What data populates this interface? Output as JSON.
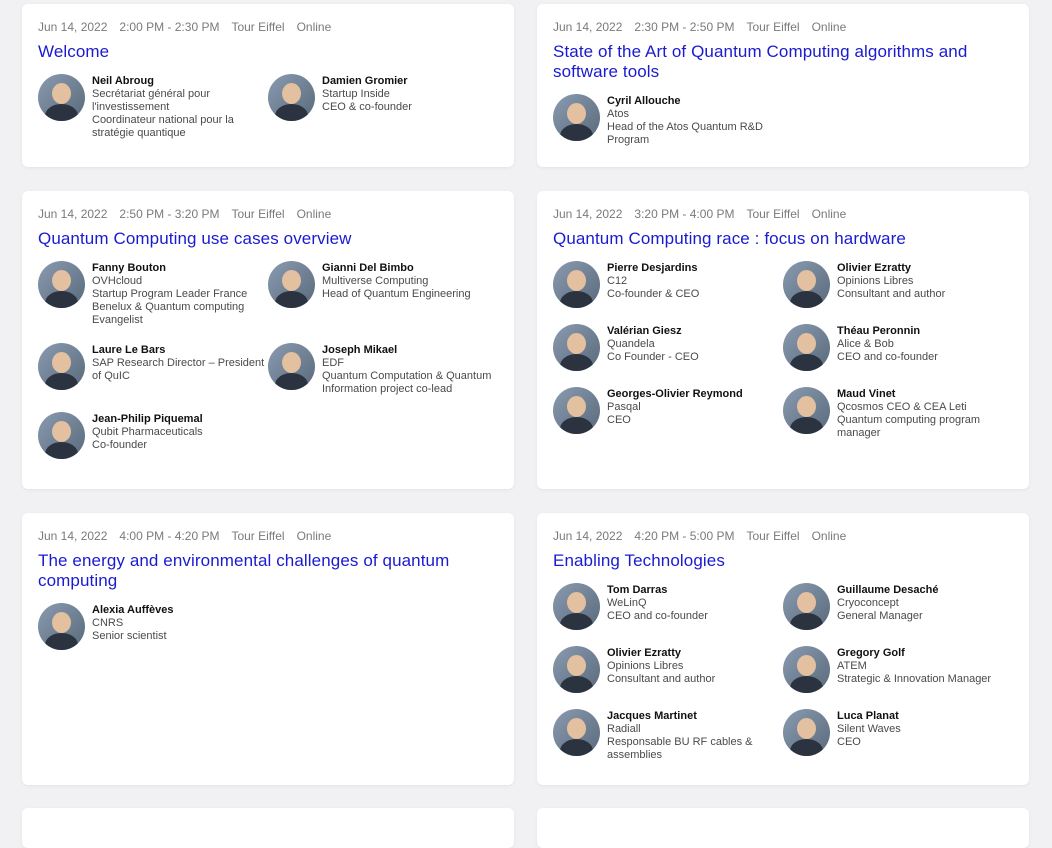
{
  "sessions": [
    {
      "date": "Jun 14, 2022",
      "time": "2:00 PM - 2:30 PM",
      "venue": "Tour Eiffel",
      "mode": "Online",
      "title": "Welcome",
      "speakers": [
        {
          "name": "Neil Abroug",
          "lines": [
            "Secrétariat général pour l'investissement",
            "Coordinateur national pour la stratégie quantique"
          ]
        },
        {
          "name": "Damien Gromier",
          "lines": [
            "Startup Inside",
            "CEO & co-founder"
          ]
        }
      ]
    },
    {
      "date": "Jun 14, 2022",
      "time": "2:30 PM - 2:50 PM",
      "venue": "Tour Eiffel",
      "mode": "Online",
      "title": "State of the Art of Quantum Computing algorithms and software tools",
      "speakers": [
        {
          "name": "Cyril Allouche",
          "lines": [
            "Atos",
            "Head of the Atos Quantum R&D Program"
          ]
        }
      ]
    },
    {
      "date": "Jun 14, 2022",
      "time": "2:50 PM - 3:20 PM",
      "venue": "Tour Eiffel",
      "mode": "Online",
      "title": "Quantum Computing use cases overview",
      "speakers": [
        {
          "name": "Fanny Bouton",
          "lines": [
            "OVHcloud",
            "Startup Program Leader France Benelux & Quantum computing Evangelist"
          ]
        },
        {
          "name": "Gianni Del Bimbo",
          "lines": [
            "Multiverse Computing",
            "Head of Quantum Engineering"
          ]
        },
        {
          "name": "Laure Le Bars",
          "lines": [
            "SAP Research Director – President of QuIC"
          ]
        },
        {
          "name": "Joseph Mikael",
          "lines": [
            "EDF",
            "Quantum Computation & Quantum Information project co-lead"
          ]
        },
        {
          "name": "Jean-Philip Piquemal",
          "lines": [
            "Qubit Pharmaceuticals",
            "Co-founder"
          ]
        }
      ]
    },
    {
      "date": "Jun 14, 2022",
      "time": "3:20 PM - 4:00 PM",
      "venue": "Tour Eiffel",
      "mode": "Online",
      "title": "Quantum Computing race : focus on hardware",
      "speakers": [
        {
          "name": "Pierre Desjardins",
          "lines": [
            "C12",
            "Co-founder & CEO"
          ]
        },
        {
          "name": "Olivier Ezratty",
          "lines": [
            "Opinions Libres",
            "Consultant and author"
          ]
        },
        {
          "name": "Valérian Giesz",
          "lines": [
            "Quandela",
            "Co Founder - CEO"
          ]
        },
        {
          "name": "Théau Peronnin",
          "lines": [
            "Alice & Bob",
            "CEO and co-founder"
          ]
        },
        {
          "name": "Georges-Olivier Reymond",
          "lines": [
            "Pasqal",
            "CEO"
          ]
        },
        {
          "name": "Maud Vinet",
          "lines": [
            "Qcosmos CEO & CEA Leti",
            "Quantum computing program manager"
          ]
        }
      ]
    },
    {
      "date": "Jun 14, 2022",
      "time": "4:00 PM - 4:20 PM",
      "venue": "Tour Eiffel",
      "mode": "Online",
      "title": "The energy and environmental challenges of quantum computing",
      "speakers": [
        {
          "name": "Alexia Auffèves",
          "lines": [
            "CNRS",
            "Senior scientist"
          ]
        }
      ]
    },
    {
      "date": "Jun 14, 2022",
      "time": "4:20 PM - 5:00 PM",
      "venue": "Tour Eiffel",
      "mode": "Online",
      "title": "Enabling Technologies",
      "speakers": [
        {
          "name": "Tom Darras",
          "lines": [
            "WeLinQ",
            "CEO and co-founder"
          ]
        },
        {
          "name": "Guillaume Desaché",
          "lines": [
            "Cryoconcept",
            "General Manager"
          ]
        },
        {
          "name": "Olivier Ezratty",
          "lines": [
            "Opinions Libres",
            "Consultant and author"
          ]
        },
        {
          "name": "Gregory Golf",
          "lines": [
            "ATEM",
            "Strategic & Innovation Manager"
          ]
        },
        {
          "name": "Jacques Martinet",
          "lines": [
            "Radiall",
            "Responsable BU RF cables & assemblies"
          ]
        },
        {
          "name": "Luca Planat",
          "lines": [
            "Silent Waves",
            "CEO"
          ]
        }
      ]
    }
  ]
}
